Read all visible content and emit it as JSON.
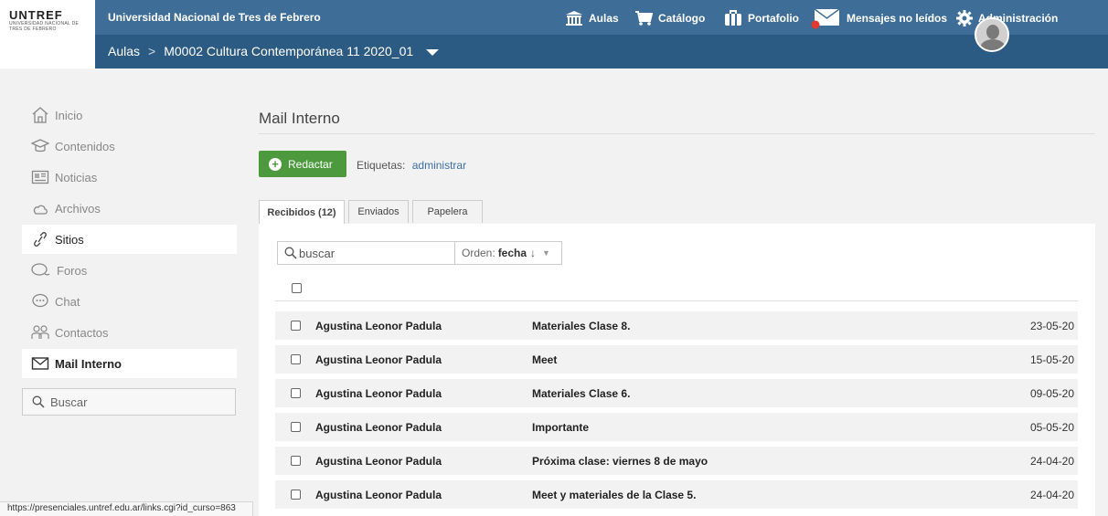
{
  "logo": {
    "title": "UNTREF",
    "subtitle": "Universidad Nacional de Tres de Febrero"
  },
  "header": {
    "site_name": "Universidad Nacional de Tres de Febrero",
    "nav": [
      {
        "label": "Aulas",
        "icon": "building-icon"
      },
      {
        "label": "Catálogo",
        "icon": "cart-icon"
      },
      {
        "label": "Portafolio",
        "icon": "briefcase-icon"
      },
      {
        "label": "Mensajes no leídos",
        "icon": "envelope-icon"
      },
      {
        "label": "Administración",
        "icon": "gear-icon"
      }
    ],
    "breadcrumb": {
      "root": "Aulas",
      "separator": ">",
      "current": "M0002 Cultura Contemporánea 11 2020_01"
    }
  },
  "sidebar": {
    "items": [
      {
        "label": "Inicio",
        "icon": "home-icon"
      },
      {
        "label": "Contenidos",
        "icon": "graduation-cap-icon"
      },
      {
        "label": "Noticias",
        "icon": "newspaper-icon"
      },
      {
        "label": "Archivos",
        "icon": "cloud-icon"
      },
      {
        "label": "Sitios",
        "icon": "link-icon"
      },
      {
        "label": "Foros",
        "icon": "chat-bubbles-icon"
      },
      {
        "label": "Chat",
        "icon": "chat-icon"
      },
      {
        "label": "Contactos",
        "icon": "people-icon"
      },
      {
        "label": "Mail Interno",
        "icon": "mail-icon"
      }
    ],
    "search_label": "Buscar"
  },
  "status_url": "https://presenciales.untref.edu.ar/links.cgi?id_curso=863",
  "main": {
    "title": "Mail Interno",
    "compose_label": "Redactar",
    "labels_prefix": "Etiquetas:",
    "labels_link": "administrar",
    "tabs": [
      {
        "label": "Recibidos (12)"
      },
      {
        "label": "Enviados"
      },
      {
        "label": "Papelera"
      }
    ],
    "search_placeholder": "buscar",
    "order_prefix": "Orden:",
    "order_value": "fecha",
    "order_arrow": "↓",
    "messages": [
      {
        "from": "Agustina Leonor Padula",
        "subject": "Materiales Clase 8.",
        "date": "23-05-20"
      },
      {
        "from": "Agustina Leonor Padula",
        "subject": "Meet",
        "date": "15-05-20"
      },
      {
        "from": "Agustina Leonor Padula",
        "subject": "Materiales Clase 6.",
        "date": "09-05-20"
      },
      {
        "from": "Agustina Leonor Padula",
        "subject": "Importante",
        "date": "05-05-20"
      },
      {
        "from": "Agustina Leonor Padula",
        "subject": "Próxima clase: viernes 8 de mayo",
        "date": "24-04-20"
      },
      {
        "from": "Agustina Leonor Padula",
        "subject": "Meet y materiales de la Clase 5.",
        "date": "24-04-20"
      }
    ]
  },
  "colors": {
    "topbar": "#3e6e97",
    "subbar": "#2b5a82",
    "compose": "#4d9a3e",
    "link": "#3a6ea5"
  }
}
